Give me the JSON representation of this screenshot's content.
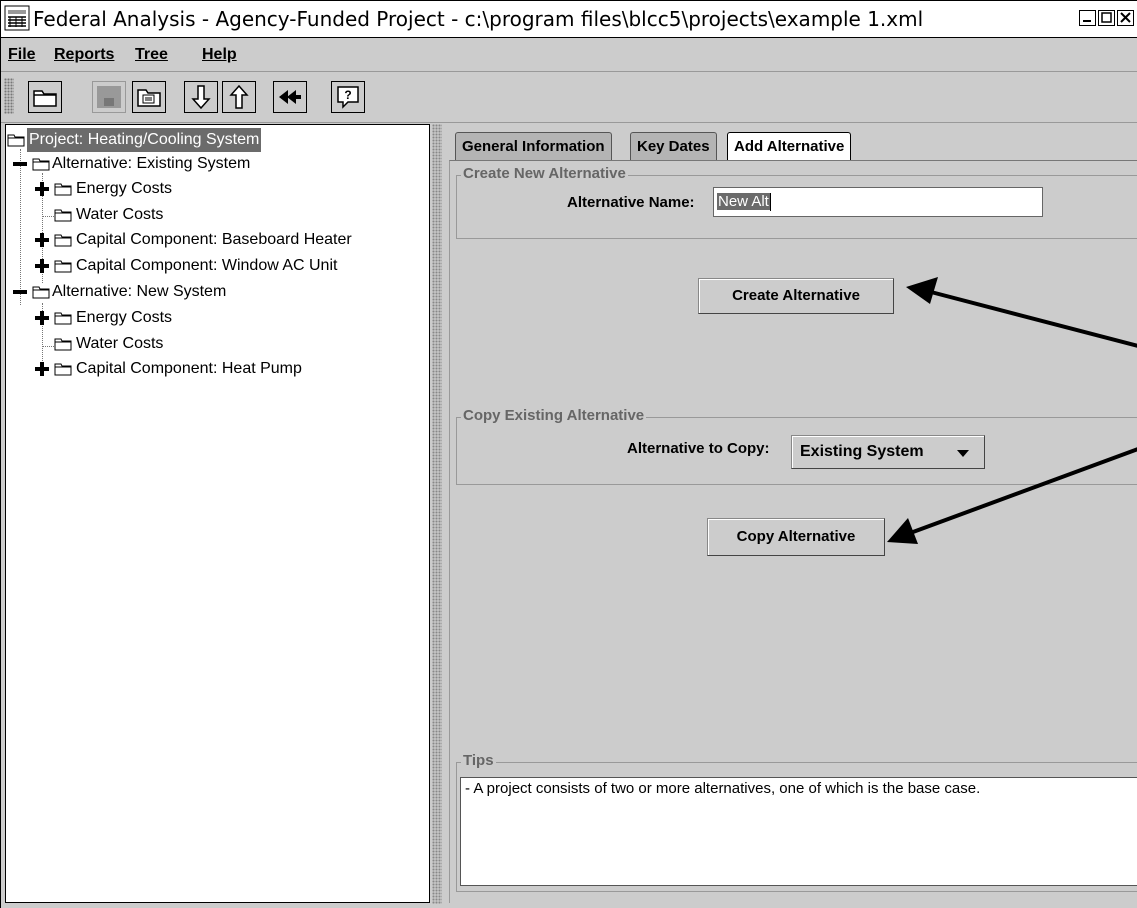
{
  "window": {
    "title": "Federal Analysis - Agency-Funded Project - c:\\program files\\blcc5\\projects\\example 1.xml"
  },
  "menu": {
    "items": [
      "File",
      "Reports",
      "Tree",
      "Help"
    ]
  },
  "toolbar": {
    "buttons": [
      "open-folder-icon",
      "save-icon",
      "open-file-icon",
      "arrow-down-icon",
      "arrow-up-icon",
      "rewind-icon",
      "help-icon"
    ]
  },
  "tree": {
    "nodes": [
      {
        "label": "Project:  Heating/Cooling System",
        "selected": true
      },
      {
        "label": "Alternative: Existing System"
      },
      {
        "label": "Energy Costs"
      },
      {
        "label": "Water Costs"
      },
      {
        "label": "Capital Component: Baseboard Heater"
      },
      {
        "label": "Capital Component: Window AC Unit"
      },
      {
        "label": "Alternative: New System"
      },
      {
        "label": "Energy Costs"
      },
      {
        "label": "Water Costs"
      },
      {
        "label": "Capital Component: Heat Pump"
      }
    ]
  },
  "tabs": [
    {
      "label": "General Information"
    },
    {
      "label": "Key Dates"
    },
    {
      "label": "Add Alternative",
      "active": true
    }
  ],
  "create_section": {
    "title": "Create New Alternative",
    "name_label": "Alternative Name:",
    "name_value": "New Alt",
    "button_label": "Create Alternative"
  },
  "copy_section": {
    "title": "Copy Existing Alternative",
    "copy_label": "Alternative to Copy:",
    "selected": "Existing System",
    "button_label": "Copy Alternative"
  },
  "tips": {
    "title": "Tips",
    "text": "- A project consists of two or more alternatives, one of which is the base case."
  }
}
